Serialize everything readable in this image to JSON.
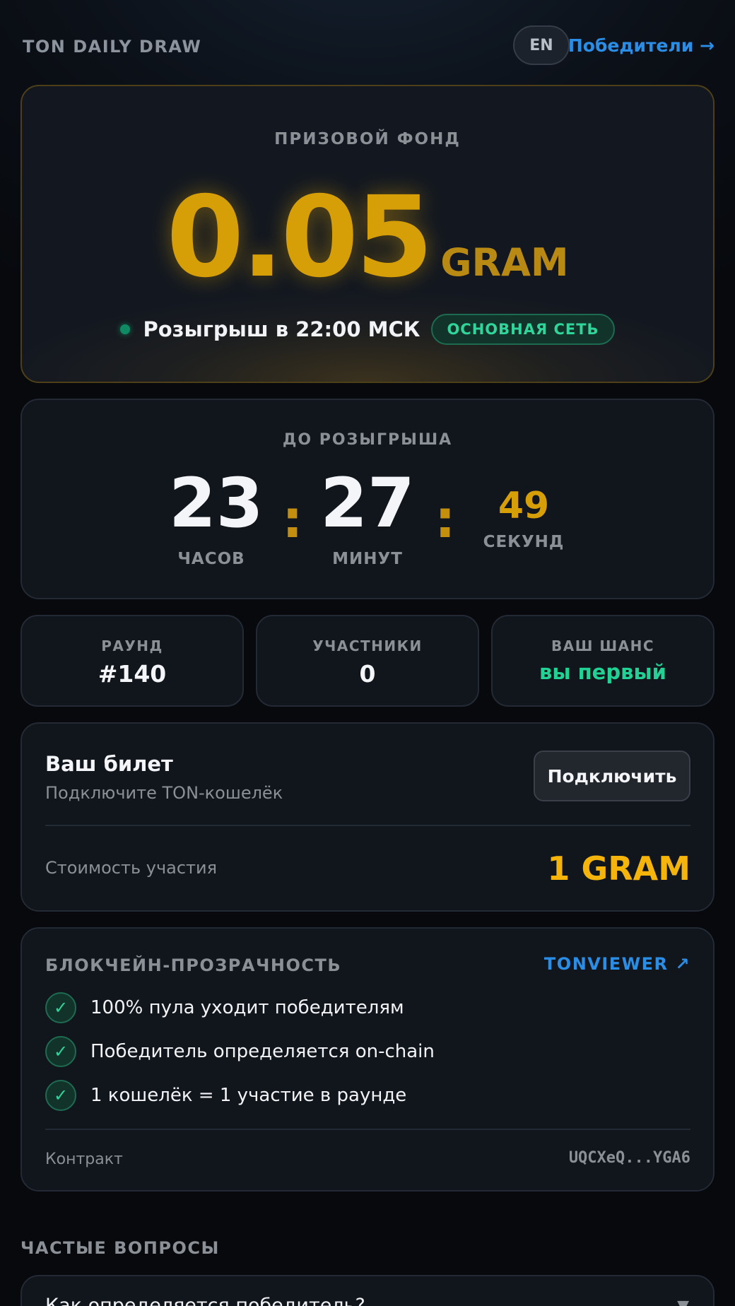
{
  "header": {
    "brand": "TON DAILY DRAW",
    "lang": "EN",
    "winners_link": "Победители →"
  },
  "prize": {
    "label": "ПРИЗОВОЙ ФОНД",
    "amount": "0.05",
    "unit": "GRAM",
    "draw_time": "Розыгрыш в 22:00 МСК",
    "network_badge": "ОСНОВНАЯ СЕТЬ"
  },
  "countdown": {
    "label": "ДО РОЗЫГРЫША",
    "hours": "23",
    "hours_label": "ЧАСОВ",
    "separator": ":",
    "minutes": "27",
    "minutes_label": "МИНУТ",
    "seconds": "49",
    "seconds_label": "СЕКУНД"
  },
  "stats": [
    {
      "label": "РАУНД",
      "value": "#140"
    },
    {
      "label": "УЧАСТНИКИ",
      "value": "0"
    },
    {
      "label": "ВАШ ШАНС",
      "value": "вы первый"
    }
  ],
  "ticket": {
    "title": "Ваш билет",
    "subtitle": "Подключите TON-кошелёк",
    "connect_label": "Подключить",
    "cost_label": "Стоимость участия",
    "cost_value": "1 GRAM"
  },
  "transparency": {
    "title": "БЛОКЧЕЙН-ПРОЗРАЧНОСТЬ",
    "link": "TONVIEWER ↗",
    "items": [
      "100% пула уходит победителям",
      "Победитель определяется on-chain",
      "1 кошелёк = 1 участие в раунде"
    ],
    "check_glyph": "✓",
    "contract_label": "Контракт",
    "contract_value": "UQCXeQ...YGA6"
  },
  "faq": {
    "title": "ЧАСТЫЕ ВОПРОСЫ",
    "items": [
      {
        "question": "Как определяется победитель?"
      }
    ],
    "chevron": "▼"
  },
  "colors": {
    "accent_gold": "#d69e07",
    "accent_green": "#22d194",
    "accent_blue": "#2b8ee6"
  }
}
